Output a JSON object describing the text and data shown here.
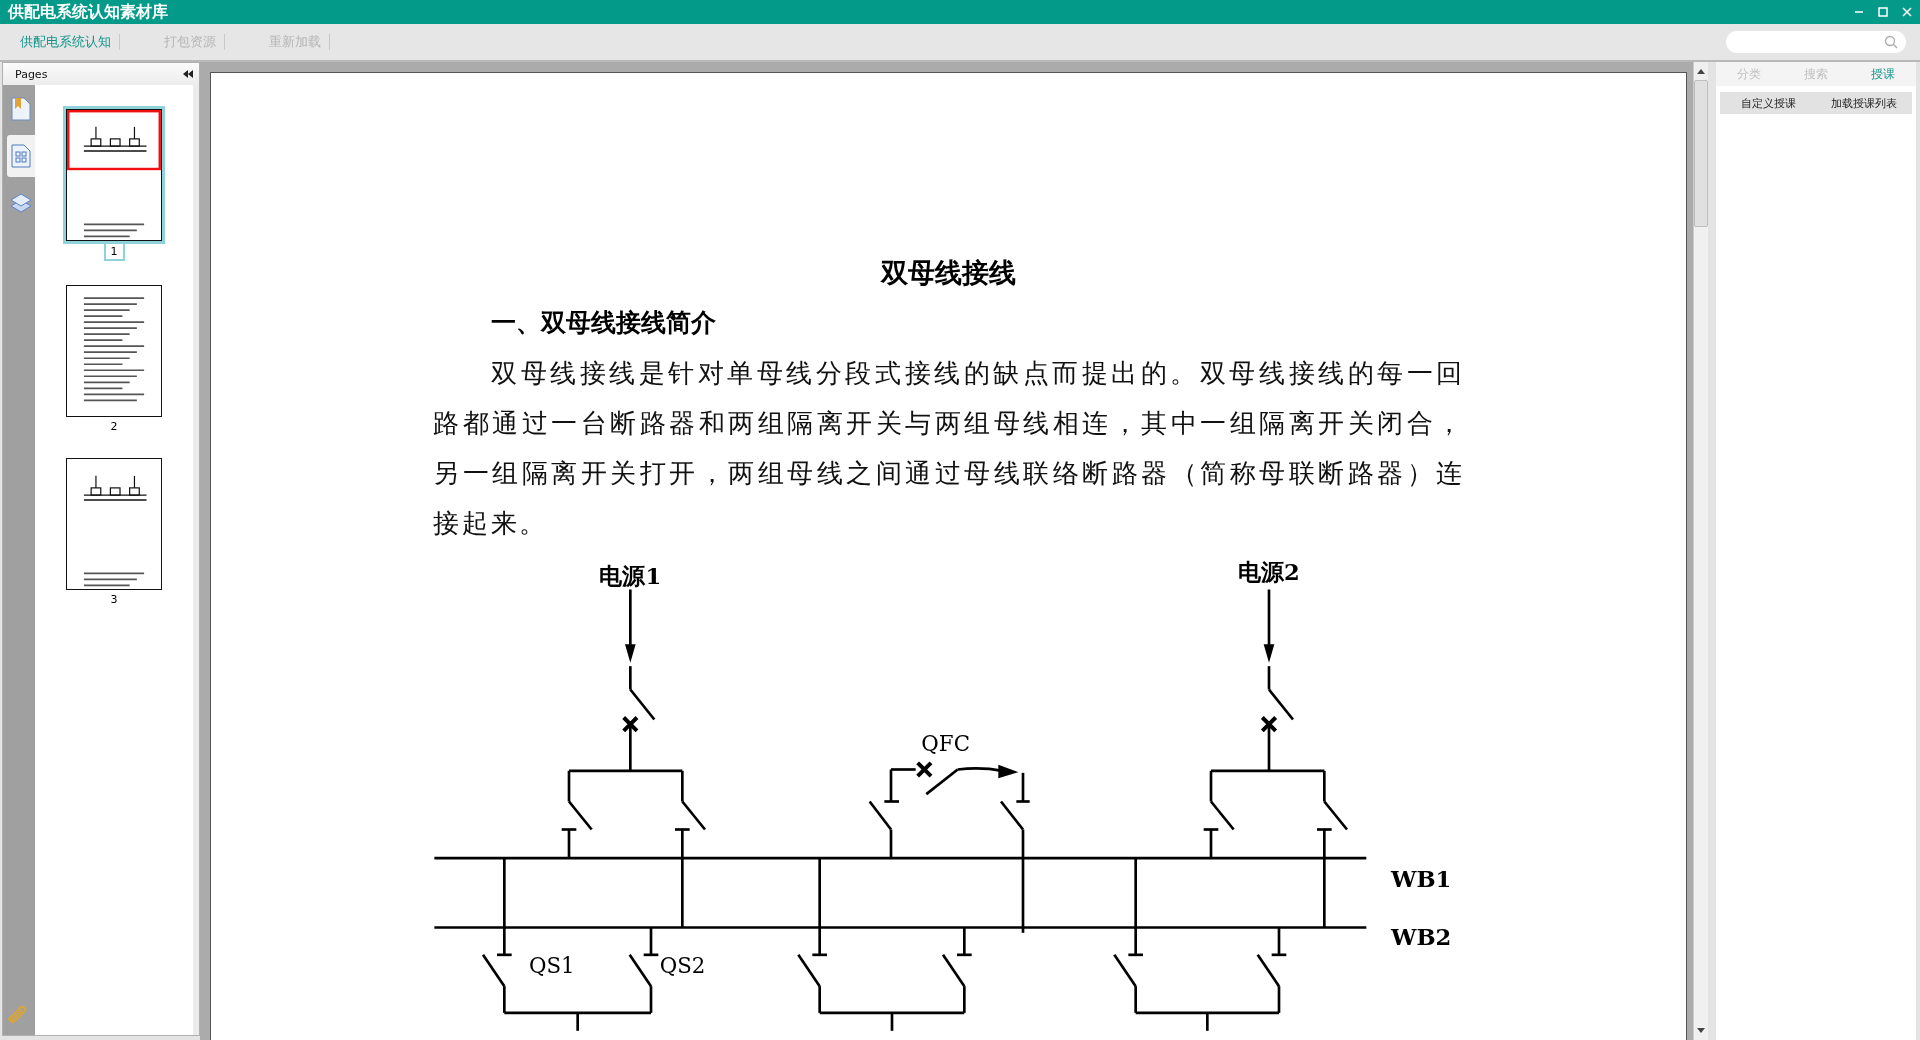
{
  "window": {
    "title": "供配电系统认知素材库"
  },
  "toolbar": {
    "tabs": [
      {
        "label": "供配电系统认知",
        "selected": true
      },
      {
        "label": "打包资源",
        "selected": false
      },
      {
        "label": "重新加载",
        "selected": false
      }
    ]
  },
  "pages_panel": {
    "title": "Pages",
    "thumbnails": [
      {
        "label": "1",
        "selected": true
      },
      {
        "label": "2",
        "selected": false
      },
      {
        "label": "3",
        "selected": false
      }
    ]
  },
  "document": {
    "title": "双母线接线",
    "heading": "一、双母线接线简介",
    "paragraph": "双母线接线是针对单母线分段式接线的缺点而提出的。双母线接线的每一回路都通过一台断路器和两组隔离开关与两组母线相连，其中一组隔离开关闭合，另一组隔离开关打开，两组母线之间通过母线联络断路器（简称母联断路器）连接起来。",
    "diagram": {
      "sources": [
        "电源1",
        "电源2"
      ],
      "coupler": "QFC",
      "buses": [
        "WB1",
        "WB2"
      ],
      "switches": [
        "QS1",
        "QS2"
      ]
    }
  },
  "right_panel": {
    "tabs": [
      {
        "label": "分类",
        "selected": false
      },
      {
        "label": "搜索",
        "selected": false
      },
      {
        "label": "授课",
        "selected": true
      }
    ],
    "buttons": [
      "自定义授课",
      "加载授课列表"
    ]
  }
}
